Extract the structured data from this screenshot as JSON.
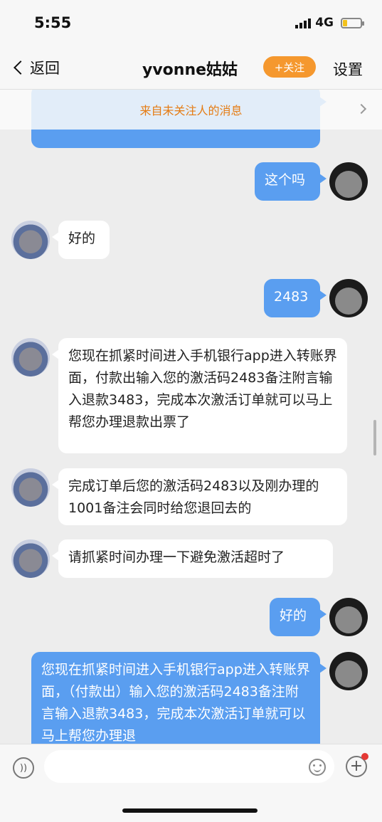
{
  "status_bar": {
    "time": "5:55",
    "network": "4G"
  },
  "nav": {
    "back_label": "返回",
    "title": "yvonne姑姑",
    "follow_label": "+关注",
    "settings_label": "设置"
  },
  "banner": {
    "text": "来自未关注人的消息"
  },
  "messages": [
    {
      "from": "me",
      "text": "这个吗"
    },
    {
      "from": "them",
      "text": "好的"
    },
    {
      "from": "me",
      "text": "2483"
    },
    {
      "from": "them",
      "text": "您现在抓紧时间进入手机银行app进入转账界面，付款出输入您的激活码2483备注附言输入退款3483，完成本次激活订单就可以马上帮您办理退款出票了"
    },
    {
      "from": "them",
      "text": "完成订单后您的激活码2483以及刚办理的1001备注会同时给您退回去的"
    },
    {
      "from": "them",
      "text": "请抓紧时间办理一下避免激活超时了"
    },
    {
      "from": "me",
      "text": "好的"
    },
    {
      "from": "me",
      "text": "您现在抓紧时间进入手机银行app进入转账界面，（付款出）输入您的激活码2483备注附言输入退款3483，完成本次激活订单就可以马上帮您办理退"
    }
  ],
  "input": {
    "placeholder": ""
  },
  "colors": {
    "accent": "#5a9ef0",
    "follow": "#f5982e",
    "banner_text": "#e57b12"
  }
}
